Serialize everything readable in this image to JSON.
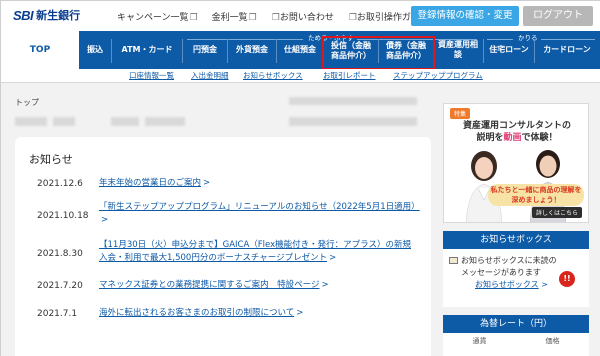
{
  "header": {
    "logo_sbi": "SBI",
    "logo_bank": "新生銀行",
    "links": [
      "キャンペーン一覧",
      "金利一覧",
      "お問い合わせ",
      "お取引操作ガイド"
    ],
    "confirm_button": "登録情報の確認・変更",
    "logout_button": "ログアウト"
  },
  "nav": {
    "items": [
      "TOP",
      "振込",
      "ATM・カード",
      "円預金",
      "外貨預金",
      "仕組預金",
      "投信（金融商品仲介）",
      "債券（金融商品仲介）",
      "資産運用相談",
      "住宅ローン",
      "カードローン"
    ],
    "group_save": "ためる・ふやす",
    "group_borrow": "かりる"
  },
  "subnav": [
    "口座情報一覧",
    "入出金明細",
    "お知らせボックス",
    "お取引レポート",
    "ステップアッププログラム"
  ],
  "breadcrumb": "トップ",
  "news": {
    "title": "お知らせ",
    "items": [
      {
        "date": "2021.12.6",
        "text": "年末年始の営業日のご案内"
      },
      {
        "date": "2021.10.18",
        "text": "「新生ステップアッププログラム」リニューアルのお知らせ（2022年5月1日適用）"
      },
      {
        "date": "2021.8.30",
        "text": "【11月30日（火）申込分まで】GAICA（Flex機能付き・発行：アプラス）の新規入会・利用で最大1,500円分のボーナスチャージプレゼント"
      },
      {
        "date": "2021.7.20",
        "text": "マネックス証券との業務提携に関するご案内　特設ページ"
      },
      {
        "date": "2021.7.1",
        "text": "海外に転出されるお客さまのお取引の制限について"
      }
    ]
  },
  "promo": {
    "tag": "特集",
    "line1": "資産運用コンサルタントの",
    "line2_a": "説明を",
    "line2_b": "動画",
    "line2_c": "で体験！",
    "bubble": "私たちと一緒に商品の理解を深めましょう！",
    "more": "詳しくはこちら"
  },
  "notice_box": {
    "title": "お知らせボックス",
    "message": "お知らせボックスに未読のメッセージがあります",
    "badge": "!!",
    "link": "お知らせボックス"
  },
  "rate": {
    "title": "為替レート（円）",
    "col1": "通貨",
    "col2": "価格"
  }
}
